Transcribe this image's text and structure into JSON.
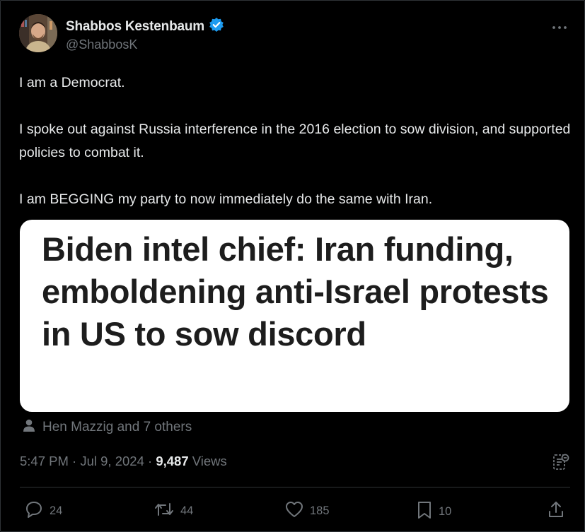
{
  "author": {
    "name": "Shabbos Kestenbaum",
    "handle": "@ShabbosK",
    "verified_color": "#1d9bf0"
  },
  "tweet": {
    "paragraphs": [
      "I am a Democrat.",
      "I spoke out against Russia interference in the 2016 election to sow division, and supported policies to combat it.",
      "I am BEGGING my party to now immediately do the same with Iran."
    ]
  },
  "media": {
    "headline": "Biden intel chief: Iran funding, emboldening anti-Israel protests in US to sow discord"
  },
  "tagged": {
    "text": "Hen Mazzig and 7 others"
  },
  "meta": {
    "time": "5:47 PM",
    "date": "Jul 9, 2024",
    "separator": "·",
    "views_count": "9,487",
    "views_label": "Views"
  },
  "actions": {
    "replies": "24",
    "reposts": "44",
    "likes": "185",
    "bookmarks": "10"
  },
  "icons": [
    "more-icon",
    "verified-badge-icon",
    "person-icon",
    "analytics-icon",
    "reply-icon",
    "repost-icon",
    "like-icon",
    "bookmark-icon",
    "share-icon"
  ]
}
